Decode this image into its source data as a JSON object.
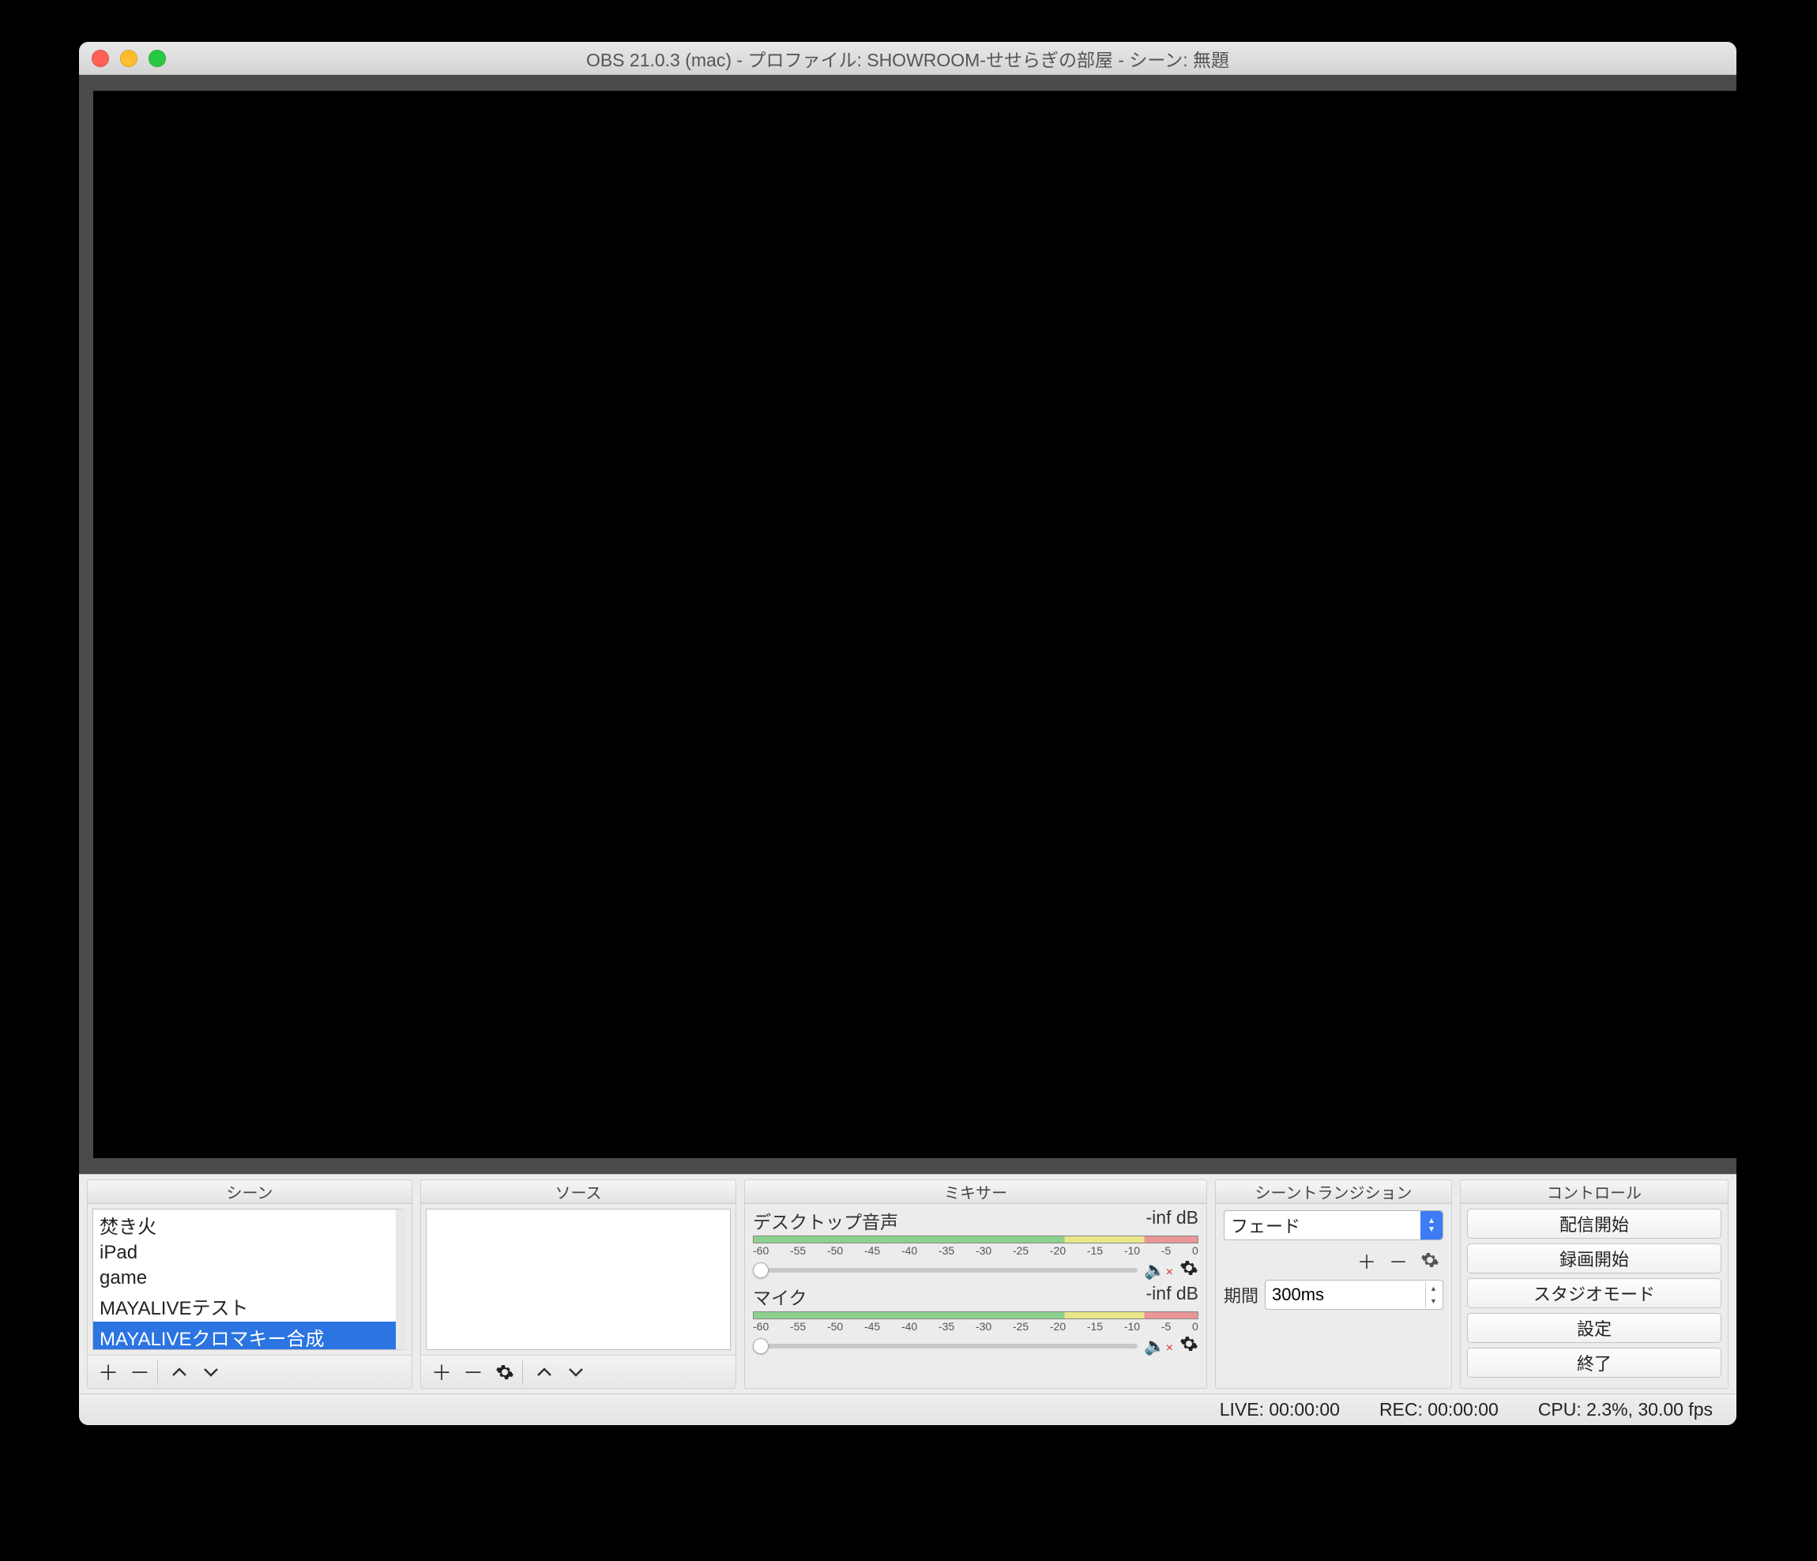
{
  "window": {
    "title": "OBS 21.0.3 (mac) - プロファイル: SHOWROOM-せせらぎの部屋 - シーン: 無題"
  },
  "panels": {
    "scenes": {
      "header": "シーン",
      "items": [
        "焚き火",
        "iPad",
        "game",
        "MAYALIVEテスト",
        "MAYALIVEクロマキー合成"
      ],
      "selected_index": 4
    },
    "sources": {
      "header": "ソース",
      "items": []
    },
    "mixer": {
      "header": "ミキサー",
      "ticks": [
        "-60",
        "-55",
        "-50",
        "-45",
        "-40",
        "-35",
        "-30",
        "-25",
        "-20",
        "-15",
        "-10",
        "-5",
        "0"
      ],
      "channels": [
        {
          "name": "デスクトップ音声",
          "level": "-inf dB",
          "muted": true
        },
        {
          "name": "マイク",
          "level": "-inf dB",
          "muted": true
        }
      ]
    },
    "transitions": {
      "header": "シーントランジション",
      "selected": "フェード",
      "duration_label": "期間",
      "duration_value": "300ms"
    },
    "controls": {
      "header": "コントロール",
      "buttons": [
        "配信開始",
        "録画開始",
        "スタジオモード",
        "設定",
        "終了"
      ]
    }
  },
  "status": {
    "live": "LIVE: 00:00:00",
    "rec": "REC: 00:00:00",
    "cpu": "CPU: 2.3%, 30.00 fps"
  }
}
